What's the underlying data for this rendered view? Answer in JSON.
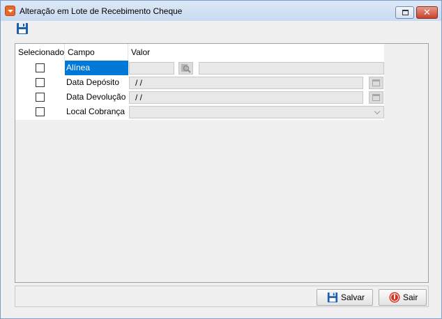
{
  "window": {
    "title": "Alteração em Lote de Recebimento Cheque"
  },
  "toolbar": {
    "save_icon": "floppy-disk-icon"
  },
  "grid": {
    "columns": [
      "Selecionado",
      "Campo",
      "Valor"
    ],
    "rows": [
      {
        "selected": false,
        "campo": "Alínea",
        "valor": "",
        "valor2": "",
        "button_icon": "search-icon"
      },
      {
        "selected": false,
        "campo": "Data Depósito",
        "valor": " /  /",
        "button_icon": "calendar-icon"
      },
      {
        "selected": false,
        "campo": "Data Devolução",
        "valor": " /  /",
        "button_icon": "calendar-icon"
      },
      {
        "selected": false,
        "campo": "Local Cobrança",
        "valor": "",
        "button_icon": "chevron-down-icon"
      }
    ]
  },
  "buttons": {
    "save_label": "Salvar",
    "exit_label": "Sair"
  },
  "colors": {
    "selection": "#0078d7",
    "titlebar": "#c9dbf1"
  }
}
